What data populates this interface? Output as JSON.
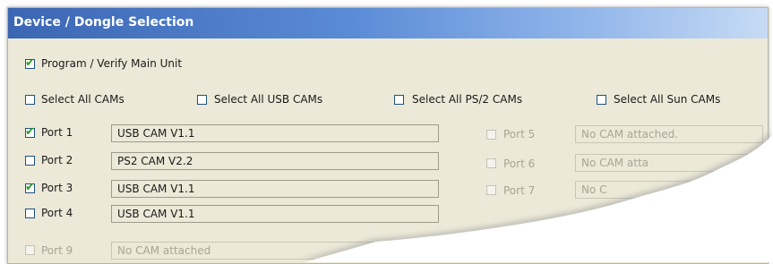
{
  "window": {
    "title": "Device / Dongle Selection"
  },
  "main_unit": {
    "label": "Program / Verify Main Unit",
    "checked": true
  },
  "select_all": [
    {
      "label": "Select All CAMs",
      "checked": false
    },
    {
      "label": "Select All USB CAMs",
      "checked": false
    },
    {
      "label": "Select All PS/2 CAMs",
      "checked": false
    },
    {
      "label": "Select All Sun CAMs",
      "checked": false
    }
  ],
  "ports_left": [
    {
      "label": "Port 1",
      "checked": true,
      "value": "USB CAM V1.1"
    },
    {
      "label": "Port 2",
      "checked": false,
      "value": "PS2 CAM V2.2"
    },
    {
      "label": "Port 3",
      "checked": true,
      "value": "USB CAM V1.1"
    },
    {
      "label": "Port 4",
      "checked": false,
      "value": "USB CAM V1.1"
    }
  ],
  "ports_right": [
    {
      "label": "Port 5",
      "value": "No CAM attached."
    },
    {
      "label": "Port 6",
      "value": "No CAM atta"
    },
    {
      "label": "Port 7",
      "value": "No C"
    }
  ],
  "port_9": {
    "label": "Port 9",
    "value": "No CAM attached"
  },
  "check_glyph": "✔"
}
